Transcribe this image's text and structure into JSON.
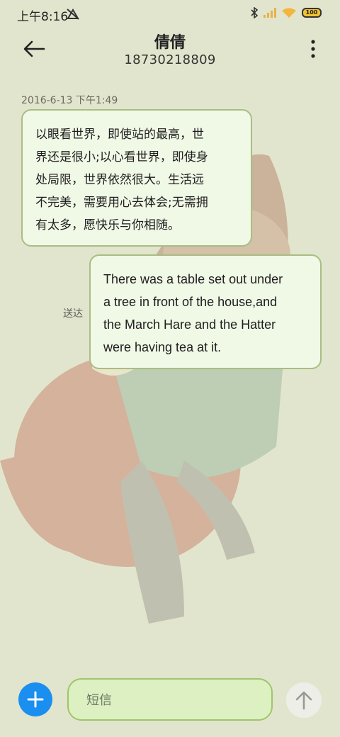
{
  "status_bar": {
    "time": "上午8:16",
    "battery": "100",
    "icons": [
      "mute-icon",
      "bluetooth-icon",
      "signal-icon",
      "wifi-icon",
      "battery-icon"
    ]
  },
  "header": {
    "back_icon": "arrow-left-icon",
    "contact_name": "倩倩",
    "contact_number": "18730218809",
    "more_icon": "more-vertical-icon"
  },
  "conversation": {
    "timestamp": "2016-6-13 下午1:49",
    "messages": [
      {
        "direction": "incoming",
        "text": "以眼看世界，即使站的最高，世\n界还是很小;以心看世界，即使身\n处局限，世界依然很大。生活远\n不完美，需要用心去体会;无需拥\n有太多，愿快乐与你相随。"
      },
      {
        "direction": "outgoing",
        "text": "There was a table set out under\na tree in front of the house,and\nthe March Hare and the Hatter\nwere having tea at it.",
        "status": "送达"
      }
    ]
  },
  "composer": {
    "add_icon": "plus-icon",
    "placeholder": "短信",
    "send_icon": "arrow-up-icon"
  },
  "colors": {
    "background": "#e2e5cd",
    "bubble_bg": "#f0f8e6",
    "bubble_border": "#a9bd84",
    "accent": "#1a8fef",
    "input_bg": "#dcf0c2"
  }
}
